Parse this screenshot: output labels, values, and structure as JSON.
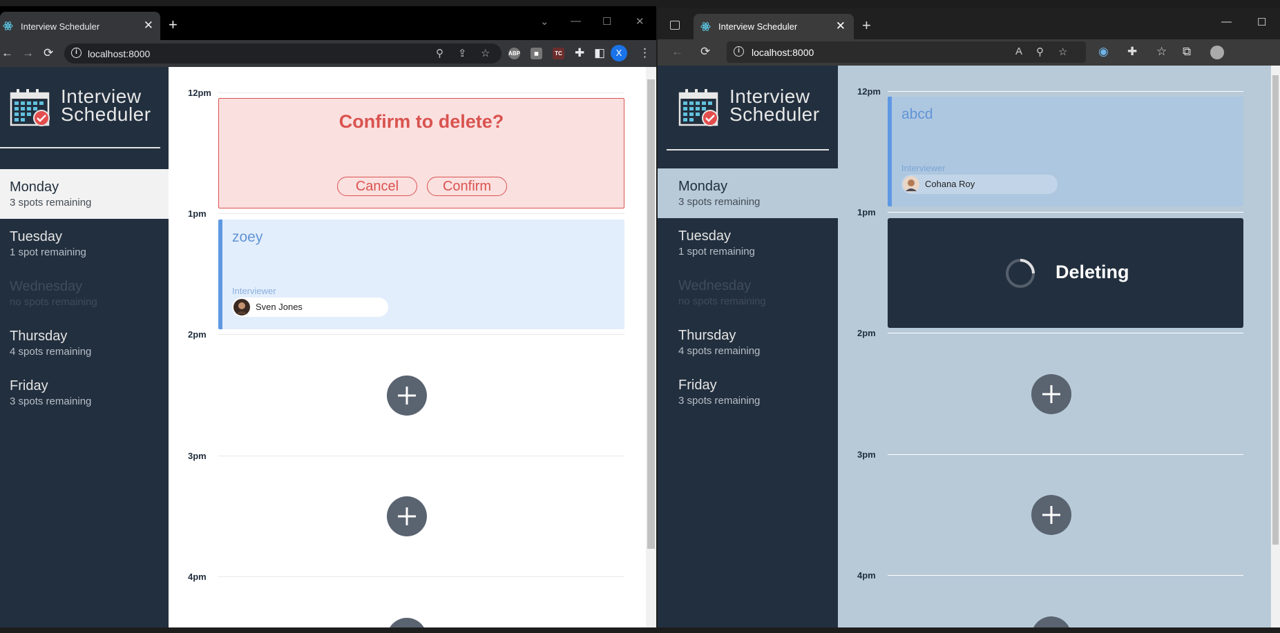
{
  "left_browser": {
    "tab_title": "Interview Scheduler",
    "url": "localhost:8000",
    "extension_label": "ABP",
    "extension_label_2": "TC",
    "profile_initial": "X"
  },
  "right_browser": {
    "tab_title": "Interview Scheduler",
    "url": "localhost:8000"
  },
  "left_app": {
    "logo_line1": "Interview",
    "logo_line2": "Scheduler",
    "days": [
      {
        "name": "Monday",
        "spots": "3 spots remaining"
      },
      {
        "name": "Tuesday",
        "spots": "1 spot remaining"
      },
      {
        "name": "Wednesday",
        "spots": "no spots remaining"
      },
      {
        "name": "Thursday",
        "spots": "4 spots remaining"
      },
      {
        "name": "Friday",
        "spots": "3 spots remaining"
      }
    ],
    "hours": [
      "12pm",
      "1pm",
      "2pm",
      "3pm",
      "4pm"
    ],
    "confirm": {
      "message": "Confirm to delete?",
      "cancel_label": "Cancel",
      "confirm_label": "Confirm"
    },
    "appointment": {
      "student": "zoey",
      "interviewer_label": "Interviewer",
      "interviewer": "Sven Jones"
    }
  },
  "right_app": {
    "logo_line1": "Interview",
    "logo_line2": "Scheduler",
    "days": [
      {
        "name": "Monday",
        "spots": "3 spots remaining"
      },
      {
        "name": "Tuesday",
        "spots": "1 spot remaining"
      },
      {
        "name": "Wednesday",
        "spots": "no spots remaining"
      },
      {
        "name": "Thursday",
        "spots": "4 spots remaining"
      },
      {
        "name": "Friday",
        "spots": "3 spots remaining"
      }
    ],
    "hours": [
      "12pm",
      "1pm",
      "2pm",
      "3pm",
      "4pm"
    ],
    "appointment": {
      "student": "abcd",
      "interviewer_label": "Interviewer",
      "interviewer": "Cohana Roy"
    },
    "status": {
      "message": "Deleting"
    }
  },
  "colors": {
    "sidebar": "#222f3e",
    "danger": "#d9534f",
    "card_accent": "#5e98e3",
    "add_button": "#5a6370"
  }
}
